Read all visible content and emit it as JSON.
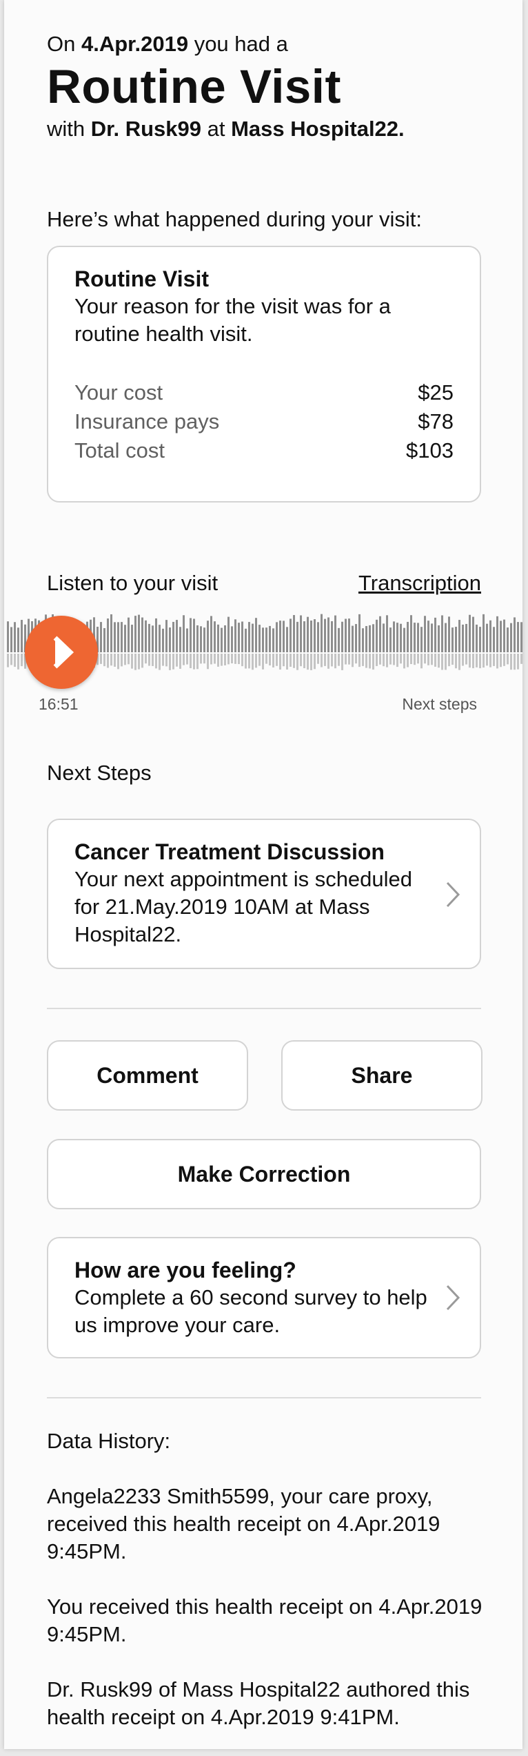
{
  "intro": {
    "prefix": "On ",
    "date": "4.Apr.2019",
    "suffix": " you had a",
    "title": "Routine Visit",
    "with_prefix": "with ",
    "doctor": "Dr. Rusk99",
    "at_text": " at ",
    "hospital": "Mass Hospital22."
  },
  "visit_section": {
    "label": "Here’s what happened during your visit:",
    "card_title": "Routine Visit",
    "card_text": "Your reason for the visit was for a routine health visit.",
    "costs": [
      {
        "label": "Your cost",
        "value": "$25"
      },
      {
        "label": "Insurance pays",
        "value": "$78"
      },
      {
        "label": "Total cost",
        "value": "$103"
      }
    ]
  },
  "audio": {
    "label": "Listen to your visit",
    "transcription_link": "Transcription",
    "time": "16:51",
    "marker": "Next steps",
    "accent_color": "#ee6632"
  },
  "next_steps": {
    "label": "Next Steps",
    "card_title": "Cancer Treatment Discussion",
    "card_text": "Your next appointment is scheduled for 21.May.2019 10AM at Mass Hospital22.",
    "icon": "chevron-right-icon"
  },
  "actions": {
    "comment": "Comment",
    "share": "Share",
    "correction": "Make Correction"
  },
  "survey": {
    "title": "How are you feeling?",
    "text": "Complete a 60 second survey to help us improve your care.",
    "icon": "chevron-right-icon"
  },
  "history": {
    "label": "Data History:",
    "entries": [
      "Angela2233 Smith5599, your care proxy, received this health receipt on 4.Apr.2019 9:45PM.",
      "You received this health receipt on 4.Apr.2019 9:45PM.",
      "Dr. Rusk99 of Mass Hospital22 authored this health receipt on 4.Apr.2019 9:41PM."
    ]
  }
}
